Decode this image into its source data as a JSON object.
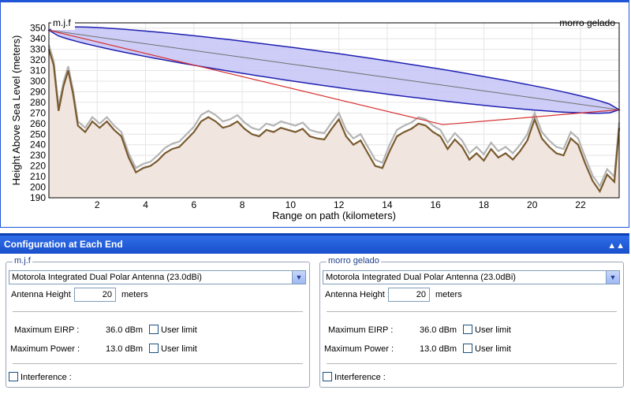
{
  "chart_data": {
    "type": "area",
    "title": "",
    "xlabel": "Range on path (kilometers)",
    "ylabel": "Height Above Sea Level (meters)",
    "xlim": [
      0,
      23.6
    ],
    "ylim": [
      190,
      355
    ],
    "xticks": [
      2,
      4,
      6,
      8,
      10,
      12,
      14,
      16,
      18,
      20,
      22
    ],
    "yticks": [
      190,
      200,
      210,
      220,
      230,
      240,
      250,
      260,
      270,
      280,
      290,
      300,
      310,
      320,
      330,
      340,
      350
    ],
    "grid": true,
    "endpoint_labels": {
      "left": "m.j.f",
      "right": "morro gelado"
    },
    "terrain": {
      "x": [
        0,
        0.2,
        0.4,
        0.6,
        0.8,
        1.0,
        1.2,
        1.5,
        1.8,
        2.1,
        2.4,
        2.7,
        3.0,
        3.3,
        3.6,
        3.9,
        4.2,
        4.5,
        4.8,
        5.1,
        5.4,
        5.7,
        6.0,
        6.3,
        6.6,
        6.9,
        7.2,
        7.5,
        7.8,
        8.1,
        8.4,
        8.7,
        9.0,
        9.3,
        9.6,
        9.9,
        10.2,
        10.5,
        10.8,
        11.1,
        11.4,
        11.7,
        12.0,
        12.3,
        12.6,
        12.9,
        13.2,
        13.5,
        13.8,
        14.1,
        14.4,
        14.7,
        15.0,
        15.3,
        15.6,
        15.9,
        16.2,
        16.5,
        16.8,
        17.1,
        17.4,
        17.7,
        18.0,
        18.3,
        18.6,
        18.9,
        19.2,
        19.5,
        19.8,
        20.1,
        20.4,
        20.7,
        21.0,
        21.3,
        21.6,
        21.9,
        22.2,
        22.5,
        22.8,
        23.1,
        23.4,
        23.6
      ],
      "values": [
        330,
        315,
        272,
        295,
        310,
        288,
        258,
        252,
        262,
        256,
        262,
        254,
        248,
        228,
        214,
        218,
        220,
        225,
        232,
        236,
        238,
        245,
        252,
        262,
        266,
        262,
        256,
        258,
        262,
        255,
        250,
        248,
        254,
        252,
        256,
        254,
        252,
        255,
        248,
        246,
        245,
        255,
        264,
        248,
        240,
        244,
        232,
        220,
        218,
        234,
        248,
        252,
        255,
        260,
        258,
        252,
        248,
        236,
        245,
        238,
        226,
        232,
        225,
        236,
        228,
        232,
        226,
        234,
        244,
        264,
        246,
        238,
        232,
        230,
        246,
        240,
        222,
        206,
        196,
        212,
        205,
        256
      ]
    },
    "clearance": {
      "x": [
        0,
        0.2,
        0.4,
        0.6,
        0.8,
        1.0,
        1.2,
        1.5,
        1.8,
        2.1,
        2.4,
        2.7,
        3.0,
        3.3,
        3.6,
        3.9,
        4.2,
        4.5,
        4.8,
        5.1,
        5.4,
        5.7,
        6.0,
        6.3,
        6.6,
        6.9,
        7.2,
        7.5,
        7.8,
        8.1,
        8.4,
        8.7,
        9.0,
        9.3,
        9.6,
        9.9,
        10.2,
        10.5,
        10.8,
        11.1,
        11.4,
        11.7,
        12.0,
        12.3,
        12.6,
        12.9,
        13.2,
        13.5,
        13.8,
        14.1,
        14.4,
        14.7,
        15.0,
        15.3,
        15.6,
        15.9,
        16.2,
        16.5,
        16.8,
        17.1,
        17.4,
        17.7,
        18.0,
        18.3,
        18.6,
        18.9,
        19.2,
        19.5,
        19.8,
        20.1,
        20.4,
        20.7,
        21.0,
        21.3,
        21.6,
        21.9,
        22.2,
        22.5,
        22.8,
        23.1,
        23.4,
        23.6
      ],
      "values": [
        334,
        319,
        276,
        299,
        314,
        292,
        262,
        256,
        266,
        260,
        266,
        258,
        252,
        232,
        218,
        222,
        224,
        230,
        237,
        241,
        243,
        250,
        257,
        268,
        272,
        268,
        262,
        264,
        268,
        261,
        256,
        254,
        260,
        258,
        262,
        260,
        258,
        261,
        254,
        252,
        251,
        261,
        270,
        254,
        246,
        250,
        238,
        226,
        223,
        240,
        254,
        258,
        261,
        266,
        264,
        258,
        254,
        242,
        251,
        244,
        232,
        238,
        231,
        242,
        234,
        238,
        232,
        240,
        250,
        270,
        252,
        244,
        238,
        236,
        252,
        246,
        228,
        211,
        201,
        217,
        210,
        261
      ]
    },
    "los_line": {
      "x": [
        0,
        23.6
      ],
      "y": [
        348,
        273
      ]
    },
    "fresnel_zone": {
      "x": [
        0,
        23.6
      ],
      "y": [
        348,
        273
      ],
      "max_radius_m": 16
    },
    "obstructed_path": {
      "x": [
        0,
        16.3,
        23.6
      ],
      "y": [
        348,
        259,
        273
      ]
    },
    "colors": {
      "terrain_line": "#7a5a2e",
      "clearance_line": "#b4b4b4",
      "terrain_fill": "#f0e6df",
      "fresnel_fill": "#c4c4f7",
      "fresnel_edge": "#2020b0",
      "obstructed_line": "#d83030",
      "los_line": "#707070"
    }
  },
  "config": {
    "title": "Configuration at Each End",
    "collapse_icon": "double-chevron-up-icon",
    "ends": [
      {
        "name": "m.j.f",
        "antenna": "Motorola Integrated Dual Polar Antenna (23.0dBi)",
        "antenna_height_label": "Antenna Height :",
        "antenna_height": "20",
        "height_unit": "meters",
        "max_eirp_label": "Maximum EIRP :",
        "max_eirp": "36.0 dBm",
        "max_power_label": "Maximum Power :",
        "max_power": "13.0 dBm",
        "user_limit_label": "User limit",
        "interference_label": "Interference :"
      },
      {
        "name": "morro gelado",
        "antenna": "Motorola Integrated Dual Polar Antenna (23.0dBi)",
        "antenna_height_label": "Antenna Height :",
        "antenna_height": "20",
        "height_unit": "meters",
        "max_eirp_label": "Maximum EIRP :",
        "max_eirp": "36.0 dBm",
        "max_power_label": "Maximum Power :",
        "max_power": "13.0 dBm",
        "user_limit_label": "User limit",
        "interference_label": "Interference :"
      }
    ]
  }
}
